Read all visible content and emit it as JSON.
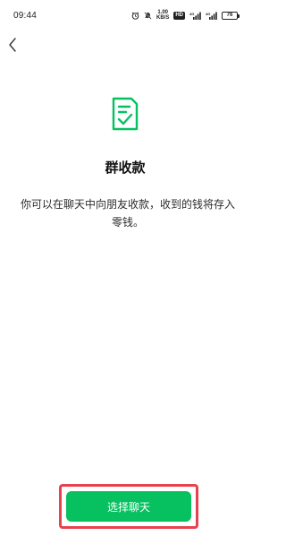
{
  "status_bar": {
    "time": "09:44",
    "net_speed_value": "1.00",
    "net_speed_unit": "KB/S",
    "hd_badge": "HD",
    "battery_level": "76",
    "icons": [
      "alarm-icon",
      "mute-icon",
      "signal-icon",
      "signal-icon",
      "battery-icon"
    ]
  },
  "nav": {
    "back_icon": "chevron-left-icon"
  },
  "content": {
    "icon": "document-check-icon",
    "title": "群收款",
    "description": "你可以在聊天中向朋友收款，收到的钱将存入零钱。"
  },
  "actions": {
    "select_chat_label": "选择聊天"
  },
  "colors": {
    "accent": "#07c160",
    "highlight": "#e8424f",
    "text": "#191919"
  }
}
